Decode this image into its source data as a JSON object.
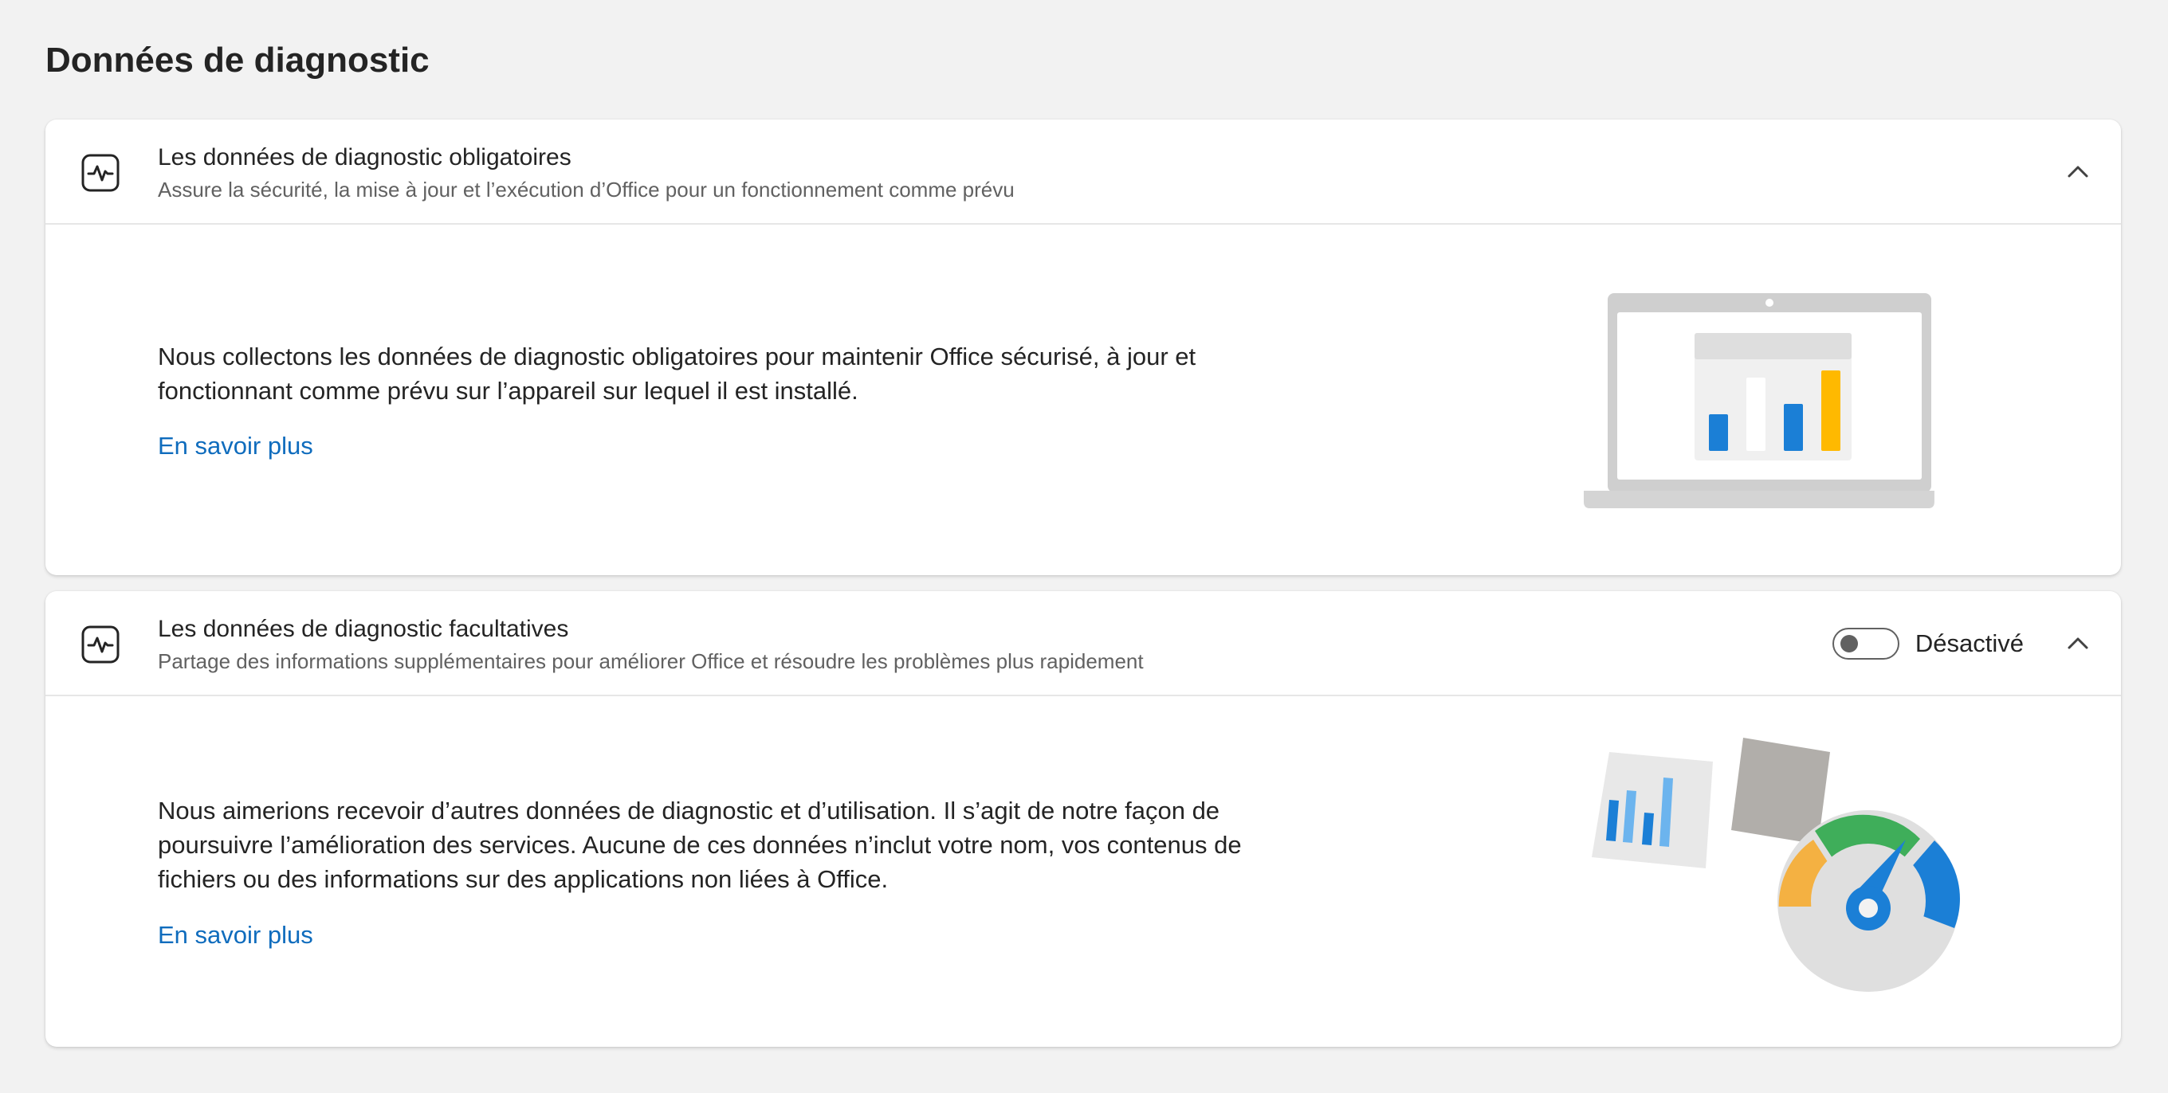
{
  "page": {
    "title": "Données de diagnostic"
  },
  "required": {
    "title": "Les données de diagnostic obligatoires",
    "subtitle": "Assure la sécurité, la mise à jour et l’exécution d’Office pour un fonctionnement comme prévu",
    "icon": "pulse-icon",
    "expanded": true,
    "body_line1": "Nous collectons les données de diagnostic obligatoires pour maintenir Office sécurisé, à jour et",
    "body_line2": "fonctionnant comme prévu sur l’appareil sur lequel il est installé.",
    "learn_more": "En savoir plus",
    "illustration": "laptop-chart-illustration"
  },
  "optional": {
    "title": "Les données de diagnostic facultatives",
    "subtitle": "Partage des informations supplémentaires pour améliorer Office et résoudre les problèmes plus rapidement",
    "icon": "pulse-icon",
    "expanded": true,
    "toggle_state": "off",
    "toggle_label": "Désactivé",
    "body_line1": "Nous aimerions recevoir d’autres données de diagnostic et d’utilisation. Il s’agit de notre façon de",
    "body_line2": "poursuivre l’amélioration des services. Aucune de ces données n’inclut votre nom, vos contenus de",
    "body_line3": "fichiers ou des informations sur des applications non liées à Office.",
    "learn_more": "En savoir plus",
    "illustration": "gauge-chart-illustration"
  },
  "colors": {
    "link": "#0f6cbd",
    "background": "#f2f2f2",
    "card": "#ffffff",
    "blue": "#1b7fd6",
    "yellow": "#ffb900",
    "green": "#3fae5a",
    "orange": "#f4b142"
  }
}
